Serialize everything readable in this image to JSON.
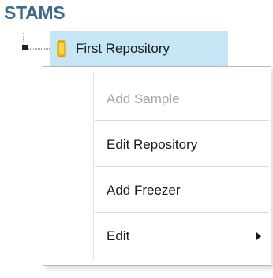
{
  "app": {
    "title": "STAMS"
  },
  "colors": {
    "title": "#3b6a8c",
    "selection_bg": "#c6e5f5",
    "text": "#1a1a1a",
    "disabled_text": "#a6a6a6",
    "repository_icon": "#f2b400"
  },
  "tree": {
    "root_node": {
      "label": "First Repository",
      "icon": "repository-icon",
      "selected": true
    }
  },
  "context_menu": {
    "items": [
      {
        "label": "Add Sample",
        "enabled": false,
        "has_submenu": false
      },
      {
        "label": "Edit Repository",
        "enabled": true,
        "has_submenu": false
      },
      {
        "label": "Add Freezer",
        "enabled": true,
        "has_submenu": false
      },
      {
        "label": "Edit",
        "enabled": true,
        "has_submenu": true,
        "submenu_icon": "chevron-right-icon"
      }
    ]
  }
}
